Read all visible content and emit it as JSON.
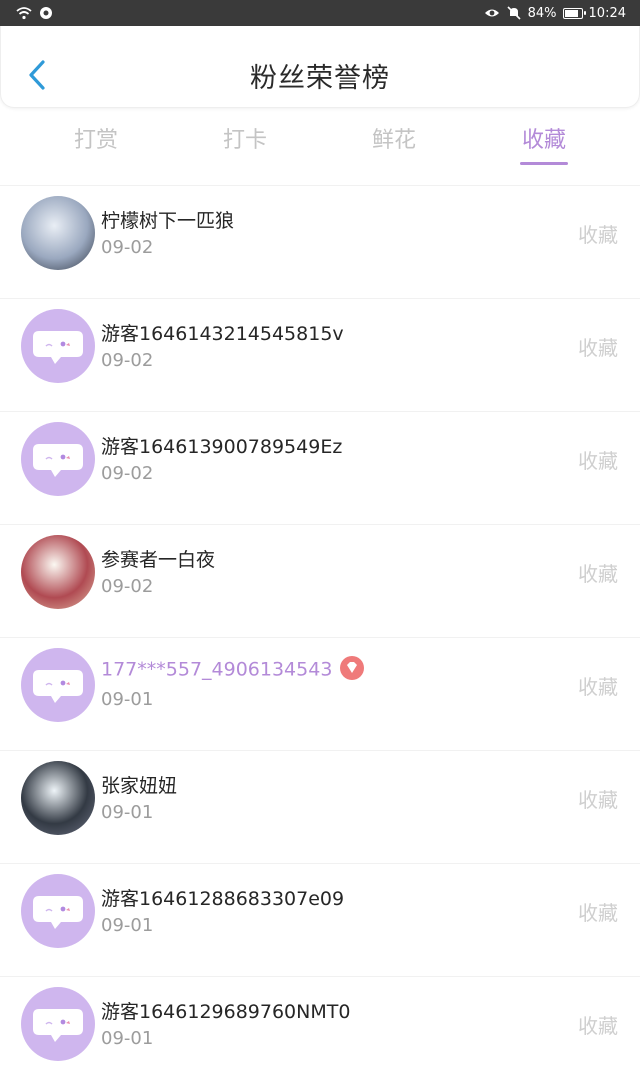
{
  "statusbar": {
    "battery": "84%",
    "time": "10:24"
  },
  "header": {
    "title": "粉丝荣誉榜"
  },
  "tabs": [
    {
      "label": "打赏",
      "active": false
    },
    {
      "label": "打卡",
      "active": false
    },
    {
      "label": "鲜花",
      "active": false
    },
    {
      "label": "收藏",
      "active": true
    }
  ],
  "colors": {
    "accent": "#b38ad8",
    "guest_avatar": "#cfb6ee",
    "badge": "#ef7a7a"
  },
  "items": [
    {
      "name": "柠檬树下一匹狼",
      "date": "09-02",
      "action": "收藏",
      "avatar": "photo-avatar",
      "vip": false
    },
    {
      "name": "游客1646143214545815v",
      "date": "09-02",
      "action": "收藏",
      "avatar": "guest-chat-avatar",
      "vip": false
    },
    {
      "name": "游客164613900789549Ez",
      "date": "09-02",
      "action": "收藏",
      "avatar": "guest-chat-avatar",
      "vip": false
    },
    {
      "name": "参赛者一白夜",
      "date": "09-02",
      "action": "收藏",
      "avatar": "photo-avatar",
      "vip": false
    },
    {
      "name": "177***557_4906134543",
      "date": "09-01",
      "action": "收藏",
      "avatar": "guest-chat-avatar",
      "vip": true
    },
    {
      "name": "张家妞妞",
      "date": "09-01",
      "action": "收藏",
      "avatar": "photo-avatar",
      "vip": false
    },
    {
      "name": "游客16461288683307e09",
      "date": "09-01",
      "action": "收藏",
      "avatar": "guest-chat-avatar",
      "vip": false
    },
    {
      "name": "游客1646129689760NMT0",
      "date": "09-01",
      "action": "收藏",
      "avatar": "guest-chat-avatar",
      "vip": false
    }
  ]
}
